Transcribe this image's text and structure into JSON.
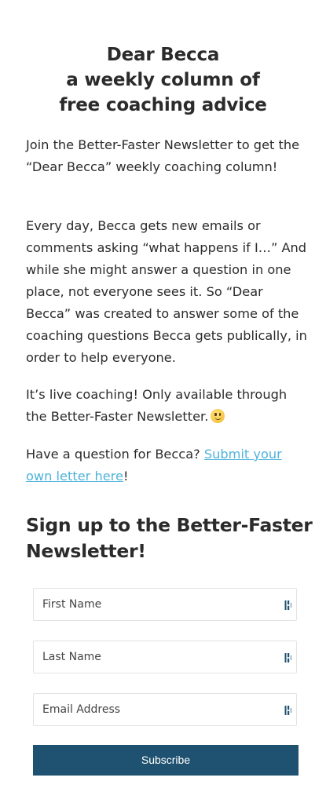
{
  "header": {
    "title_line1": "Dear Becca",
    "title_line2": "a weekly column of",
    "title_line3": "free coaching advice"
  },
  "content": {
    "paragraph1": "Join the Better-Faster Newsletter to get the “Dear Becca” weekly coaching column!",
    "paragraph2": "Every day, Becca gets new emails or comments asking “what happens if I…” And while she might answer a question in one place, not everyone sees it. So “Dear Becca” was created to answer some of the coaching questions Becca gets publically, in order to help everyone.",
    "paragraph3": "It’s live coaching! Only available through the Better-Faster Newsletter.",
    "paragraph3_emoji": "slightly-smiling-face-emoji",
    "paragraph4_prefix": "Have a question for Becca? ",
    "paragraph4_link": "Submit your own letter here",
    "paragraph4_suffix": "!"
  },
  "signup": {
    "heading": "Sign up to the Better-Faster Newsletter!",
    "first_name_placeholder": "First Name",
    "last_name_placeholder": "Last Name",
    "email_placeholder": "Email Address",
    "field_icon": "password-manager-icon",
    "subscribe_label": "Subscribe"
  },
  "colors": {
    "text": "#2b2b2b",
    "link": "#4fb3dc",
    "button": "#1f5270",
    "field_border": "#e3e3e3",
    "field_icon": "#1f5270"
  }
}
